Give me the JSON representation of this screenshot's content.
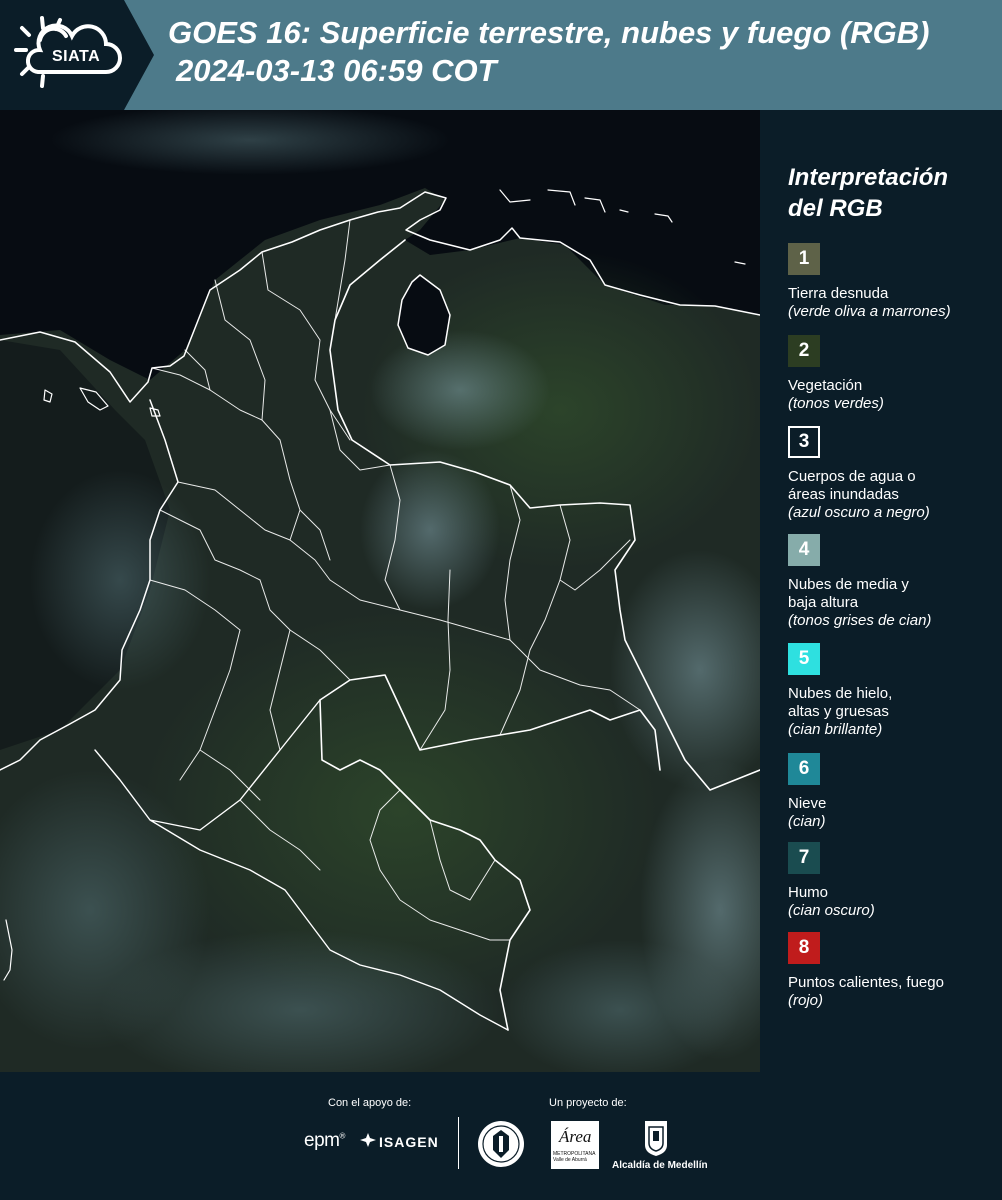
{
  "header": {
    "logo_text": "SIATA",
    "title_line1": "GOES 16: Superficie terrestre, nubes y fuego (RGB)",
    "title_line2": "2024-03-13 06:59 COT"
  },
  "legend": {
    "title_line1": "Interpretación",
    "title_line2": "del RGB",
    "items": [
      {
        "number": "1",
        "color": "#5e6248",
        "label_lines": [
          "Tierra desnuda"
        ],
        "sub": "(verde oliva a marrones)"
      },
      {
        "number": "2",
        "color": "#2c3d22",
        "label_lines": [
          "Vegetación"
        ],
        "sub": "(tonos verdes)"
      },
      {
        "number": "3",
        "color": "#0b1d28",
        "label_lines": [
          "Cuerpos de agua o",
          "áreas inundadas"
        ],
        "sub": "(azul oscuro a negro)"
      },
      {
        "number": "4",
        "color": "#86acaa",
        "label_lines": [
          "Nubes de media y",
          "baja altura"
        ],
        "sub": "(tonos grises de cian)"
      },
      {
        "number": "5",
        "color": "#2ee0e0",
        "label_lines": [
          "Nubes de hielo,",
          "altas y gruesas"
        ],
        "sub": "(cian brillante)"
      },
      {
        "number": "6",
        "color": "#1f8898",
        "label_lines": [
          "Nieve"
        ],
        "sub": "(cian)"
      },
      {
        "number": "7",
        "color": "#1a4c50",
        "label_lines": [
          "Humo"
        ],
        "sub": "(cian oscuro)"
      },
      {
        "number": "8",
        "color": "#c01c1c",
        "label_lines": [
          "Puntos calientes, fuego"
        ],
        "sub": "(rojo)"
      }
    ]
  },
  "footer": {
    "support_label": "Con el apoyo de:",
    "project_label": "Un proyecto de:",
    "epm": "epm",
    "isagen": "ISAGEN",
    "area_title": "Área",
    "area_sub1": "METROPOLITANA",
    "area_sub2": "Valle de Aburrá",
    "alcaldia": "Alcaldía de Medellín"
  },
  "colors": {
    "background": "#0b1d28",
    "header_band": "#4d7a8a",
    "map_land": "#1f2a25",
    "map_sea": "#070c12",
    "borders": "#ffffff"
  }
}
